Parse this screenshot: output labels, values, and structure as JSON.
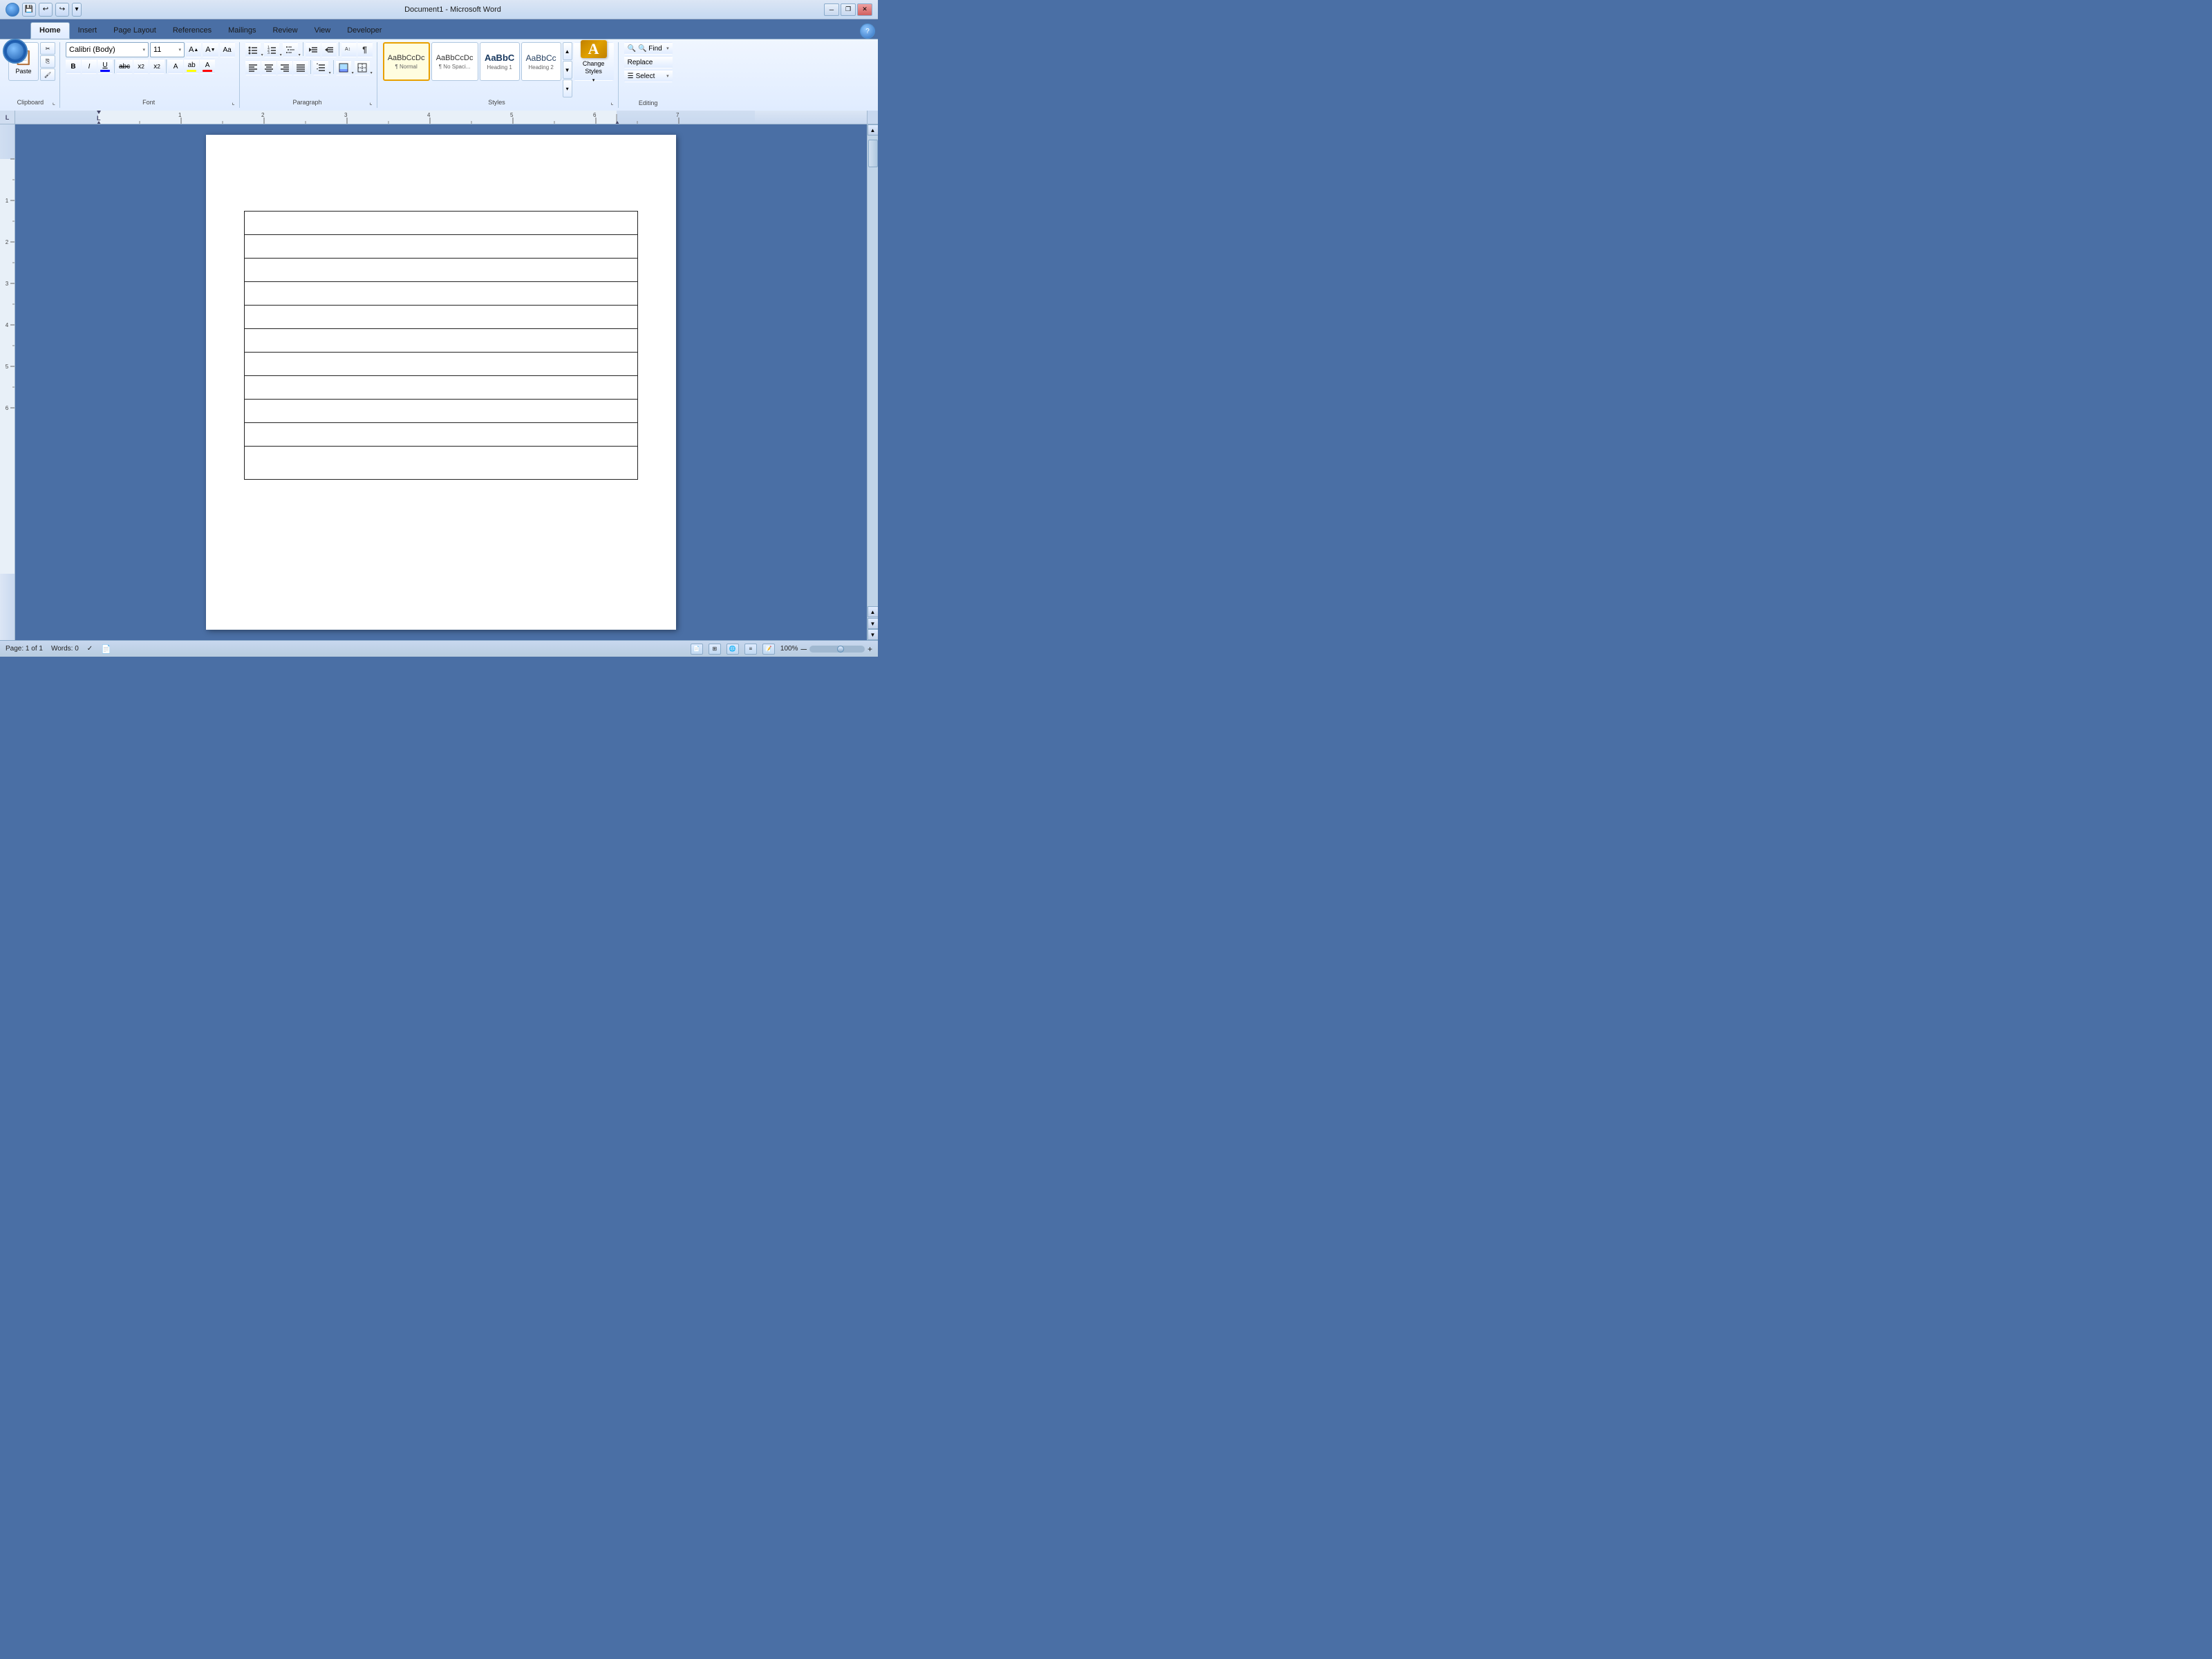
{
  "titleBar": {
    "title": "Document1 - Microsoft Word",
    "minimizeLabel": "─",
    "restoreLabel": "❐",
    "closeLabel": "✕"
  },
  "quickAccess": {
    "saveLabel": "💾",
    "undoLabel": "↩",
    "redoLabel": "↪",
    "dropdownLabel": "▾"
  },
  "tabs": [
    {
      "label": "Home",
      "active": true
    },
    {
      "label": "Insert",
      "active": false
    },
    {
      "label": "Page Layout",
      "active": false
    },
    {
      "label": "References",
      "active": false
    },
    {
      "label": "Mailings",
      "active": false
    },
    {
      "label": "Review",
      "active": false
    },
    {
      "label": "View",
      "active": false
    },
    {
      "label": "Developer",
      "active": false
    }
  ],
  "clipboard": {
    "pasteLabel": "Paste",
    "cutLabel": "✂",
    "copyLabel": "⎘",
    "formatPainterLabel": "🖌",
    "groupLabel": "Clipboard",
    "expandLabel": "⌞"
  },
  "font": {
    "name": "Calibri (Body)",
    "size": "11",
    "groupLabel": "Font",
    "expandLabel": "⌞",
    "boldLabel": "B",
    "italicLabel": "I",
    "underlineLabel": "U",
    "strikeLabel": "abc",
    "subLabel": "x₂",
    "supLabel": "x²",
    "clearLabel": "A",
    "sizeUpLabel": "A▲",
    "sizeDownLabel": "A▼",
    "charLabel": "Aa",
    "highlightColor": "#ffff00",
    "fontColor": "#ff0000"
  },
  "paragraph": {
    "groupLabel": "Paragraph",
    "expandLabel": "⌞",
    "bullets": "≡•",
    "numbering": "≡1",
    "multilevel": "≡≡",
    "decreaseIndent": "⇤",
    "increaseIndent": "⇥",
    "sort": "↕A",
    "showHide": "¶",
    "alignLeft": "≡",
    "alignCenter": "≡",
    "alignRight": "≡",
    "justify": "≡",
    "lineSpacing": "↕",
    "shading": "🔷",
    "borders": "⊞"
  },
  "styles": {
    "groupLabel": "Styles",
    "expandLabel": "⌞",
    "items": [
      {
        "label": "¶ Normal",
        "sublabel": "Normal",
        "active": true
      },
      {
        "label": "¶ No Spaci...",
        "sublabel": "No Spaci...",
        "active": false
      },
      {
        "label": "Heading 1",
        "sublabel": "Heading 1",
        "active": false
      },
      {
        "label": "Heading 2",
        "sublabel": "Heading 2",
        "active": false
      }
    ],
    "changeStylesLabel": "Change\nStyles",
    "scrollUpLabel": "▲",
    "scrollDownLabel": "▼",
    "moreLabel": "▾"
  },
  "editing": {
    "groupLabel": "Editing",
    "findLabel": "🔍 Find",
    "findDropdown": "▾",
    "replaceLabel": "Replace",
    "selectLabel": "☰ Select",
    "selectDropdown": "▾"
  },
  "ruler": {
    "cornerLabel": "L",
    "tabStop": "L"
  },
  "statusBar": {
    "pageInfo": "Page: 1 of 1",
    "wordCount": "Words: 0",
    "checkmark": "✓",
    "viewPrint": "📄",
    "zoom": "100%",
    "zoomMinus": "─",
    "zoomPlus": "+"
  },
  "document": {
    "tableRows": 11,
    "tableCols": 1
  }
}
